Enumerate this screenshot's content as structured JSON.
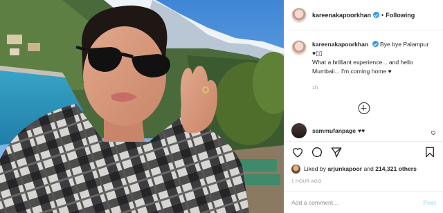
{
  "header": {
    "username": "kareenakapoorkhan",
    "separator": "•",
    "follow_label": "Following"
  },
  "caption": {
    "username": "kareenakapoorkhan",
    "line1": "Bye bye Palampur ♥▯▯",
    "line2": "What a brilliant experience... and hello Mumbaii... I'm coming home ♥",
    "time": "1h"
  },
  "comments": [
    {
      "username": "sammufanpage",
      "text": "♥♥"
    }
  ],
  "likes": {
    "prefix": "Liked by",
    "user": "arjunkapoor",
    "joiner": "and",
    "count": "214,321 others"
  },
  "posted_ago": "1 HOUR AGO",
  "add_comment": {
    "placeholder": "Add a comment...",
    "post_label": "Post"
  },
  "icons": [
    "verified-icon",
    "heart-icon",
    "comment-icon",
    "share-icon",
    "bookmark-icon",
    "load-more-icon"
  ],
  "colors": {
    "verified": "#3897f0",
    "post_disabled": "#b2dffc",
    "muted": "#8e8e8e"
  }
}
